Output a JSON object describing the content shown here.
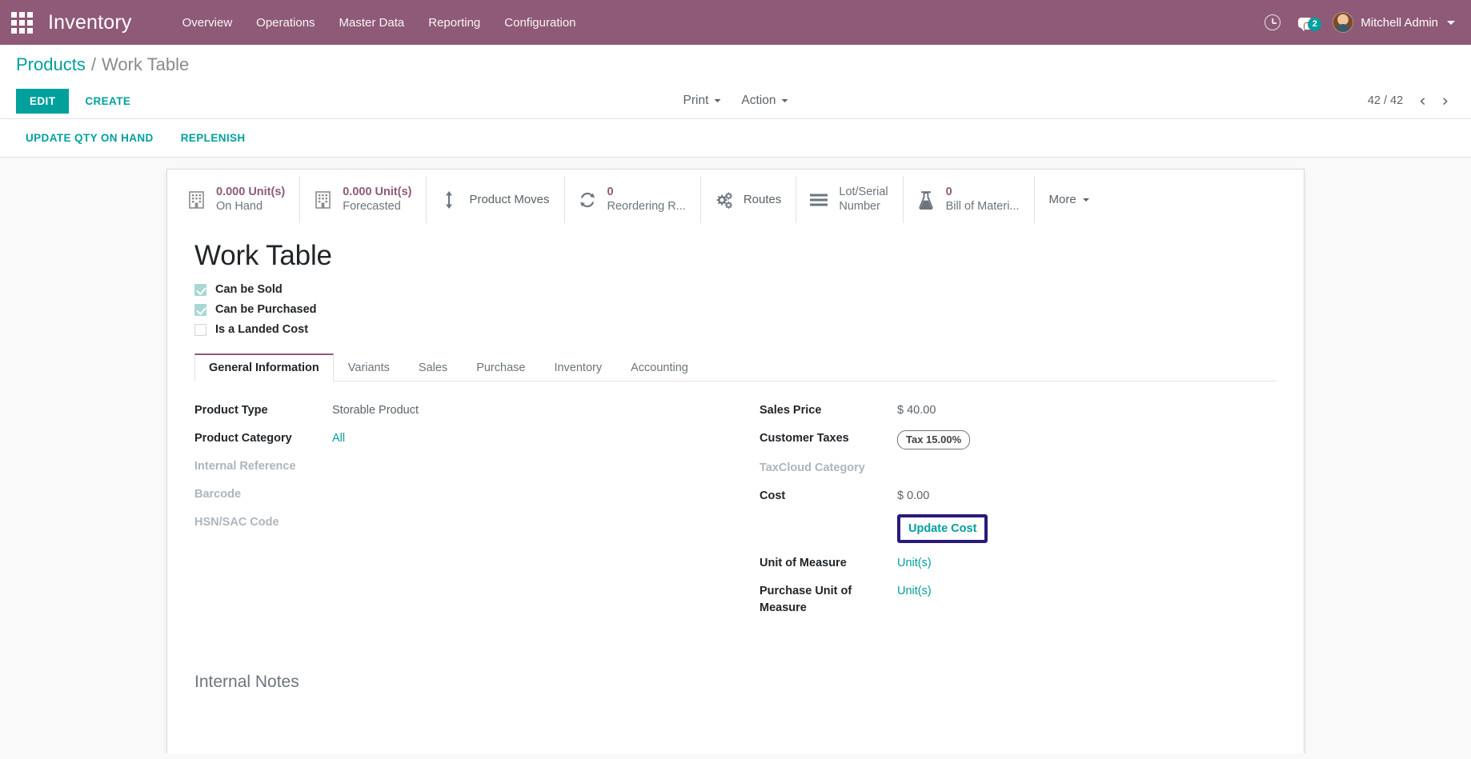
{
  "navbar": {
    "apps_icon": "apps-grid-icon",
    "brand": "Inventory",
    "menu": [
      {
        "label": "Overview"
      },
      {
        "label": "Operations"
      },
      {
        "label": "Master Data"
      },
      {
        "label": "Reporting"
      },
      {
        "label": "Configuration"
      }
    ],
    "activities_icon": "clock-icon",
    "messages_icon": "chat-bubbles-icon",
    "messages_count": "2",
    "user_name": "Mitchell Admin",
    "accent_color": "#8f5a77",
    "badge_color": "#00a09d"
  },
  "control_panel": {
    "breadcrumb": {
      "root": "Products",
      "separator": "/",
      "current": "Work Table"
    },
    "edit_label": "EDIT",
    "create_label": "CREATE",
    "print_label": "Print",
    "action_label": "Action",
    "pager_count": "42 / 42",
    "prev_icon": "chevron-left-icon",
    "next_icon": "chevron-right-icon"
  },
  "button_bar": {
    "update_qty_label": "UPDATE QTY ON HAND",
    "replenish_label": "REPLENISH"
  },
  "stat_buttons": [
    {
      "icon": "building-icon",
      "value": "0.000 Unit(s)",
      "label": "On Hand"
    },
    {
      "icon": "building-icon",
      "value": "0.000 Unit(s)",
      "label": "Forecasted"
    },
    {
      "icon": "arrows-vertical-icon",
      "value": "",
      "label": "Product Moves"
    },
    {
      "icon": "refresh-icon",
      "value": "0",
      "label": "Reordering R..."
    },
    {
      "icon": "gears-icon",
      "value": "",
      "label": "Routes"
    },
    {
      "icon": "bars-icon",
      "value": "",
      "label": "Lot/Serial Number",
      "label_line1": "Lot/Serial",
      "label_line2": "Number"
    },
    {
      "icon": "flask-icon",
      "value": "0",
      "label": "Bill of Materi..."
    }
  ],
  "stat_more": {
    "label": "More",
    "icon": "caret-down-icon"
  },
  "product": {
    "title": "Work Table",
    "checkboxes": [
      {
        "label": "Can be Sold",
        "checked": true
      },
      {
        "label": "Can be Purchased",
        "checked": true
      },
      {
        "label": "Is a Landed Cost",
        "checked": false
      }
    ]
  },
  "tabs": [
    {
      "label": "General Information",
      "active": true
    },
    {
      "label": "Variants",
      "active": false
    },
    {
      "label": "Sales",
      "active": false
    },
    {
      "label": "Purchase",
      "active": false
    },
    {
      "label": "Inventory",
      "active": false
    },
    {
      "label": "Accounting",
      "active": false
    }
  ],
  "form_left": [
    {
      "label": "Product Type",
      "value": "Storable Product",
      "muted": false,
      "link": false
    },
    {
      "label": "Product Category",
      "value": "All",
      "muted": false,
      "link": true
    },
    {
      "label": "Internal Reference",
      "value": "",
      "muted": true,
      "link": false
    },
    {
      "label": "Barcode",
      "value": "",
      "muted": true,
      "link": false
    },
    {
      "label": "HSN/SAC Code",
      "value": "",
      "muted": true,
      "link": false
    }
  ],
  "form_right": {
    "sales_price_label": "Sales Price",
    "sales_price_value": "$ 40.00",
    "customer_taxes_label": "Customer Taxes",
    "customer_taxes_tag": "Tax 15.00%",
    "taxcloud_label": "TaxCloud Category",
    "taxcloud_value": "",
    "cost_label": "Cost",
    "cost_value": "$ 0.00",
    "update_cost_label": "Update Cost",
    "uom_label": "Unit of Measure",
    "uom_value": "Unit(s)",
    "purchase_uom_label": "Purchase Unit of Measure",
    "purchase_uom_value": "Unit(s)"
  },
  "notes": {
    "title": "Internal Notes"
  },
  "highlight_color": "#2b1a7a"
}
